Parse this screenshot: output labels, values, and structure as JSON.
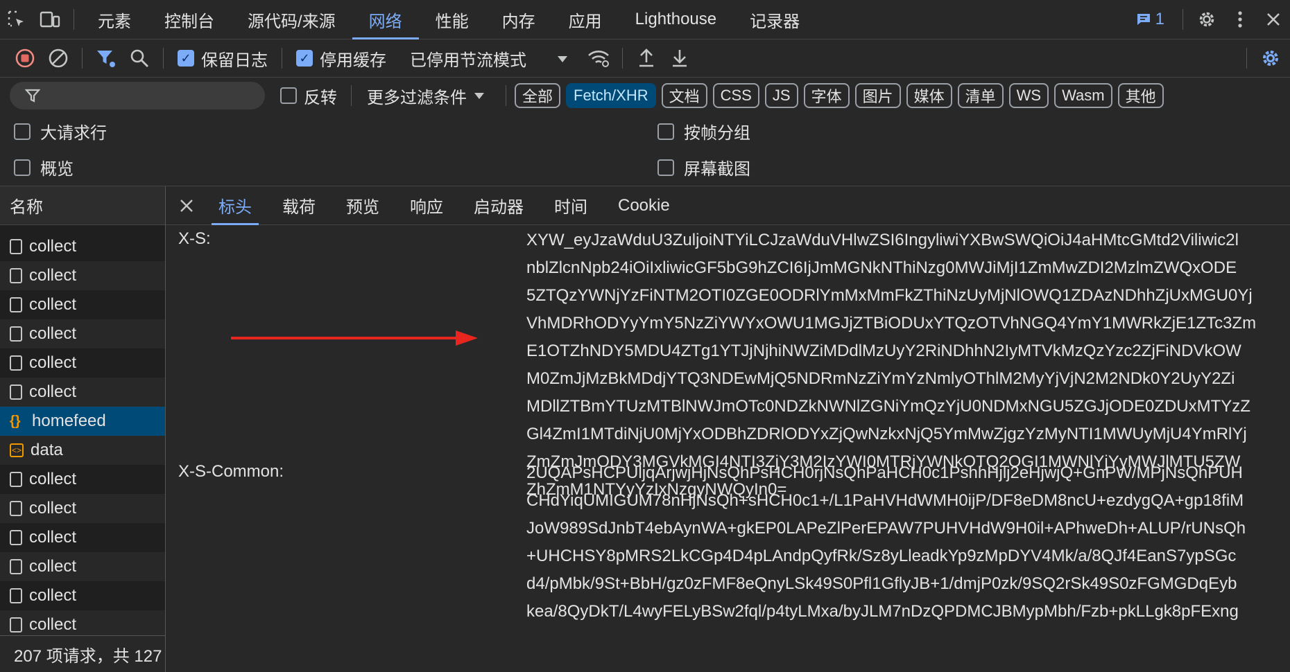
{
  "topbar": {
    "tabs": [
      "元素",
      "控制台",
      "源代码/来源",
      "网络",
      "性能",
      "内存",
      "应用",
      "Lighthouse",
      "记录器"
    ],
    "active_tab": "网络",
    "issues_count": "1"
  },
  "toolbar": {
    "preserve_log": "保留日志",
    "disable_cache": "停用缓存",
    "throttle": "已停用节流模式"
  },
  "filter": {
    "invert": "反转",
    "more_filters": "更多过滤条件",
    "chips": [
      "全部",
      "Fetch/XHR",
      "文档",
      "CSS",
      "JS",
      "字体",
      "图片",
      "媒体",
      "清单",
      "WS",
      "Wasm",
      "其他"
    ],
    "active_chip": "Fetch/XHR"
  },
  "options": {
    "big_rows": "大请求行",
    "group_by_frame": "按帧分组",
    "overview": "概览",
    "screenshots": "屏幕截图"
  },
  "requests": {
    "header": "名称",
    "items": [
      {
        "name": "collect",
        "type": "doc"
      },
      {
        "name": "collect",
        "type": "doc"
      },
      {
        "name": "collect",
        "type": "doc"
      },
      {
        "name": "collect",
        "type": "doc"
      },
      {
        "name": "collect",
        "type": "doc"
      },
      {
        "name": "collect",
        "type": "doc"
      },
      {
        "name": "homefeed",
        "type": "xhr"
      },
      {
        "name": "data",
        "type": "data"
      },
      {
        "name": "collect",
        "type": "doc"
      },
      {
        "name": "collect",
        "type": "doc"
      },
      {
        "name": "collect",
        "type": "doc"
      },
      {
        "name": "collect",
        "type": "doc"
      },
      {
        "name": "collect",
        "type": "doc"
      },
      {
        "name": "collect",
        "type": "doc"
      }
    ],
    "selected": "homefeed",
    "summary": "207 项请求，共 127"
  },
  "details": {
    "tabs": [
      "标头",
      "载荷",
      "预览",
      "响应",
      "启动器",
      "时间",
      "Cookie"
    ],
    "active_tab": "标头",
    "headers": [
      {
        "name": "X-S:",
        "lines": [
          "XYW_eyJzaWduU3ZuljoiNTYiLCJzaWduVHlwZSI6IngyliwiYXBwSWQiOiJ4aHMtcGMtd2Viliwic2l",
          "nblZlcnNpb24iOiIxliwicGF5bG9hZCI6IjJmMGNkNThiNzg0MWJiMjI1ZmMwZDI2MzlmZWQxODE",
          "5ZTQzYWNjYzFiNTM2OTI0ZGE0ODRlYmMxMmFkZThiNzUyMjNlOWQ1ZDAzNDhhZjUxMGU0Yj",
          "VhMDRhODYyYmY5NzZiYWYxOWU1MGJjZTBiODUxYTQzOTVhNGQ4YmY1MWRkZjE1ZTc3Zm",
          "E1OTZhNDY5MDU4ZTg1YTJjNjhiNWZiMDdlMzUyY2RiNDhhN2IyMTVkMzQzYzc2ZjFiNDVkOW",
          "M0ZmJjMzBkMDdjYTQ3NDEwMjQ5NDRmNzZiYmYzNmlyOThlM2MyYjVjN2M2NDk0Y2UyY2Zi",
          "MDllZTBmYTUzMTBlNWJmOTc0NDZkNWNlZGNiYmQzYjU0NDMxNGU5ZGJjODE0ZDUxMTYzZ",
          "Gl4ZmI1MTdiNjU0MjYxODBhZDRlODYxZjQwNzkxNjQ5YmMwZjgzYzMyNTI1MWUyMjU4YmRlYj",
          "ZmZmJmODY3MGVkMGI4NTI3ZjY3M2IzYWI0MTRjYWNkOTQ2OGI1MWNlYjYyMWJlMTU5ZW",
          "ZhZmM1NTYyYzIxNzgyNWQyIn0="
        ]
      },
      {
        "name": "X-S-Common:",
        "lines": [
          "2UQAPsHCPUljqArjwjHjNsQhPsHCH0rjNsQhPaHCH0c1PshhHjlj2eHjwjQ+GnPW/MPjNsQhPUH",
          "CHdYiqUMIGUM78nHjNsQh+sHCH0c1+/L1PaHVHdWMH0ijP/DF8eDM8ncU+ezdygQA+gp18fiM",
          "JoW989SdJnbT4ebAynWA+gkEP0LAPeZlPerEPAW7PUHVHdW9H0il+APhweDh+ALUP/rUNsQh",
          "+UHCHSY8pMRS2LkCGp4D4pLAndpQyfRk/Sz8yLleadkYp9zMpDYV4Mk/a/8QJf4EanS7ypSGc",
          "d4/pMbk/9St+BbH/gz0zFMF8eQnyLSk49S0Pfl1GflyJB+1/dmjP0zk/9SQ2rSk49S0zFGMGDqEyb",
          "kea/8QyDkT/L4wyFELyBSw2fql/p4tyLMxa/byJLM7nDzQPDMCJBMypMbh/Fzb+pkLLgk8pFExng"
        ]
      }
    ]
  },
  "colors": {
    "accent": "#7cacf8",
    "arrow": "#e8251f",
    "selected_row": "#004a77"
  }
}
